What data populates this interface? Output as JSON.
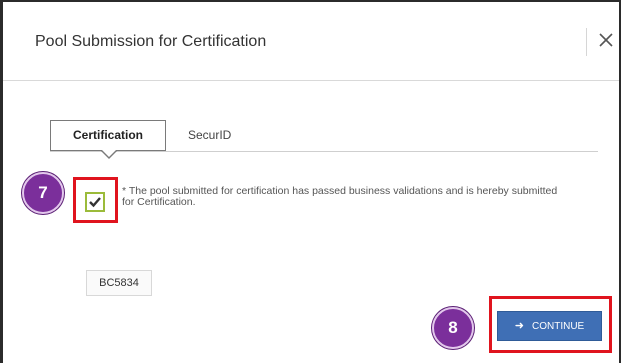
{
  "dialog": {
    "title": "Pool Submission for Certification",
    "close_glyph": "✕"
  },
  "tabs": [
    {
      "label": "Certification",
      "active": true
    },
    {
      "label": "SecurID",
      "active": false
    }
  ],
  "certification": {
    "checkbox_checked": true,
    "statement": "* The pool submitted for certification has passed business validations and is hereby submitted for Certification."
  },
  "pool_id": "BC5834",
  "continue_button": {
    "icon": "arrow-right-icon",
    "label": "CONTINUE"
  },
  "annotations": {
    "step_7": "7",
    "step_8": "8"
  },
  "colors": {
    "accent_button": "#3f6fb5",
    "highlight_red": "#e0141e",
    "badge_purple": "#7b2f9b",
    "checkbox_green": "#9bbb3a"
  }
}
